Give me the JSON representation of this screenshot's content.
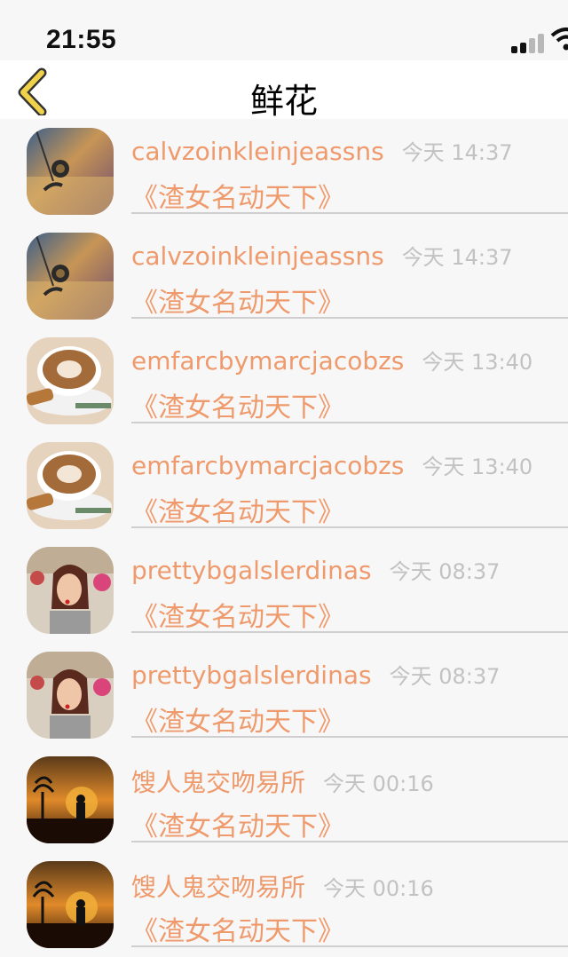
{
  "status_bar": {
    "time": "21:55"
  },
  "nav": {
    "title": "鲜花",
    "back_icon": "chevron-left-icon",
    "accent_color": "#f0d24a"
  },
  "list": {
    "items": [
      {
        "name": "calvzoinkleinjeassns",
        "time": "今天 14:37",
        "subtitle": "《渣女名动天下》",
        "avatar": "snail-avatar"
      },
      {
        "name": "calvzoinkleinjeassns",
        "time": "今天 14:37",
        "subtitle": "《渣女名动天下》",
        "avatar": "snail-avatar"
      },
      {
        "name": "emfarcbymarcjacobzs",
        "time": "今天 13:40",
        "subtitle": "《渣女名动天下》",
        "avatar": "coffee-avatar"
      },
      {
        "name": "emfarcbymarcjacobzs",
        "time": "今天 13:40",
        "subtitle": "《渣女名动天下》",
        "avatar": "coffee-avatar"
      },
      {
        "name": "prettybgalslerdinas",
        "time": "今天 08:37",
        "subtitle": "《渣女名动天下》",
        "avatar": "woman-avatar"
      },
      {
        "name": "prettybgalslerdinas",
        "time": "今天 08:37",
        "subtitle": "《渣女名动天下》",
        "avatar": "woman-avatar"
      },
      {
        "name": "馊人鬼交吻易所",
        "time": "今天 00:16",
        "subtitle": "《渣女名动天下》",
        "avatar": "sunset-avatar"
      },
      {
        "name": "馊人鬼交吻易所",
        "time": "今天 00:16",
        "subtitle": "《渣女名动天下》",
        "avatar": "sunset-avatar"
      }
    ]
  },
  "colors": {
    "name_text": "#ef9a6c",
    "time_text": "#c2c2c2",
    "divider": "#cfcfcf",
    "background": "#f7f7f7"
  }
}
